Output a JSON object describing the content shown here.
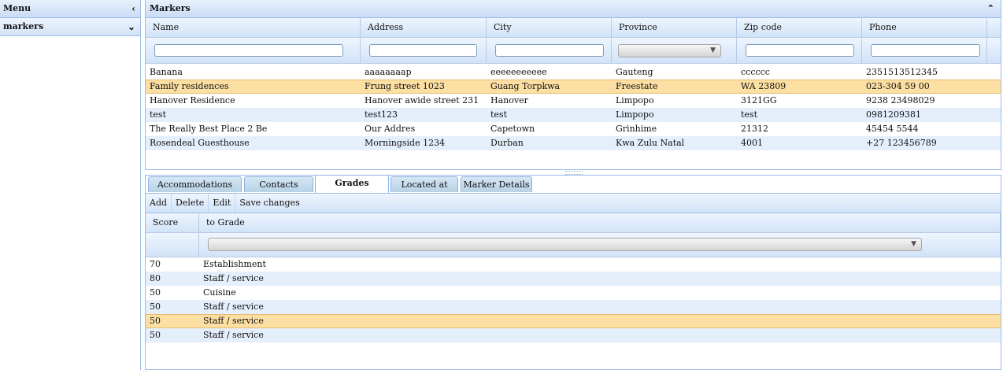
{
  "menu": {
    "title": "Menu",
    "collapse_icon": "chevron-left-icon",
    "section": "markers",
    "section_icon": "chevron-down-icon"
  },
  "markers_panel": {
    "title": "Markers",
    "columns": [
      "Name",
      "Address",
      "City",
      "Province",
      "Zip code",
      "Phone"
    ],
    "rows": [
      [
        "Banana",
        "aaaaaaaap",
        "eeeeeeeeeee",
        "Gauteng",
        "cccccc",
        "2351513512345"
      ],
      [
        "Family residences",
        "Frung street 1023",
        "Guang Torpkwa",
        "Freestate",
        "WA 23809",
        "023-304 59 00"
      ],
      [
        "Hanover Residence",
        "Hanover awide street 231",
        "Hanover",
        "Limpopo",
        "3121GG",
        "9238 23498029"
      ],
      [
        "test",
        "test123",
        "test",
        "Limpopo",
        "test",
        "0981209381"
      ],
      [
        "The Really Best Place 2 Be",
        "Our Addres",
        "Capetown",
        "Grinhime",
        "21312",
        "45454 5544"
      ],
      [
        "Rosendeal Guesthouse",
        "Morningside 1234",
        "Durban",
        "Kwa Zulu Natal",
        "4001",
        "+27 123456789"
      ]
    ],
    "selected_row": 1
  },
  "tabs": [
    "Accommodations",
    "Contacts",
    "Grades",
    "Located at",
    "Marker Details"
  ],
  "active_tab": "Grades",
  "toolbar": {
    "add": "Add",
    "delete": "Delete",
    "edit": "Edit",
    "save": "Save changes"
  },
  "grades": {
    "columns": [
      "Score",
      "to Grade"
    ],
    "rows": [
      [
        "70",
        "Establishment"
      ],
      [
        "80",
        "Staff / service"
      ],
      [
        "50",
        "Cuisine"
      ],
      [
        "50",
        "Staff / service"
      ],
      [
        "50",
        "Staff / service"
      ],
      [
        "50",
        "Staff / service"
      ]
    ],
    "selected_row": 4
  },
  "colors": {
    "header": "#c9dcf5",
    "alt_row": "#e5effc",
    "selected": "#fcdfa3",
    "border": "#99bbe8"
  }
}
